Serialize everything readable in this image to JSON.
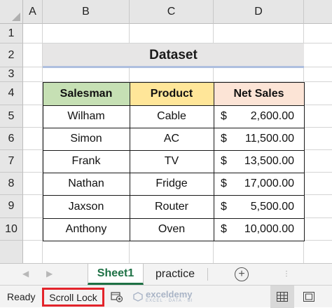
{
  "columns": [
    "A",
    "B",
    "C",
    "D"
  ],
  "rows": [
    "1",
    "2",
    "3",
    "4",
    "5",
    "6",
    "7",
    "8",
    "9",
    "10"
  ],
  "dataset_title": "Dataset",
  "table": {
    "headers": [
      "Salesman",
      "Product",
      "Net Sales"
    ],
    "header_colors": [
      "#c6e0b4",
      "#ffe699",
      "#fce4d6"
    ],
    "currency_symbol": "$",
    "records": [
      {
        "salesman": "Wilham",
        "product": "Cable",
        "net_sales": "2,600.00"
      },
      {
        "salesman": "Simon",
        "product": "AC",
        "net_sales": "11,500.00"
      },
      {
        "salesman": "Frank",
        "product": "TV",
        "net_sales": "13,500.00"
      },
      {
        "salesman": "Nathan",
        "product": "Fridge",
        "net_sales": "17,000.00"
      },
      {
        "salesman": "Jaxson",
        "product": "Router",
        "net_sales": "5,500.00"
      },
      {
        "salesman": "Anthony",
        "product": "Oven",
        "net_sales": "10,000.00"
      }
    ]
  },
  "sheet_tabs": {
    "tabs": [
      "Sheet1",
      "practice"
    ],
    "active": "Sheet1",
    "accent": "#1e7145"
  },
  "status_bar": {
    "ready": "Ready",
    "scroll_lock": "Scroll Lock",
    "highlight_color": "#e3242b",
    "watermark_name": "exceldemy",
    "watermark_tagline": "EXCEL · DATA · BI"
  }
}
